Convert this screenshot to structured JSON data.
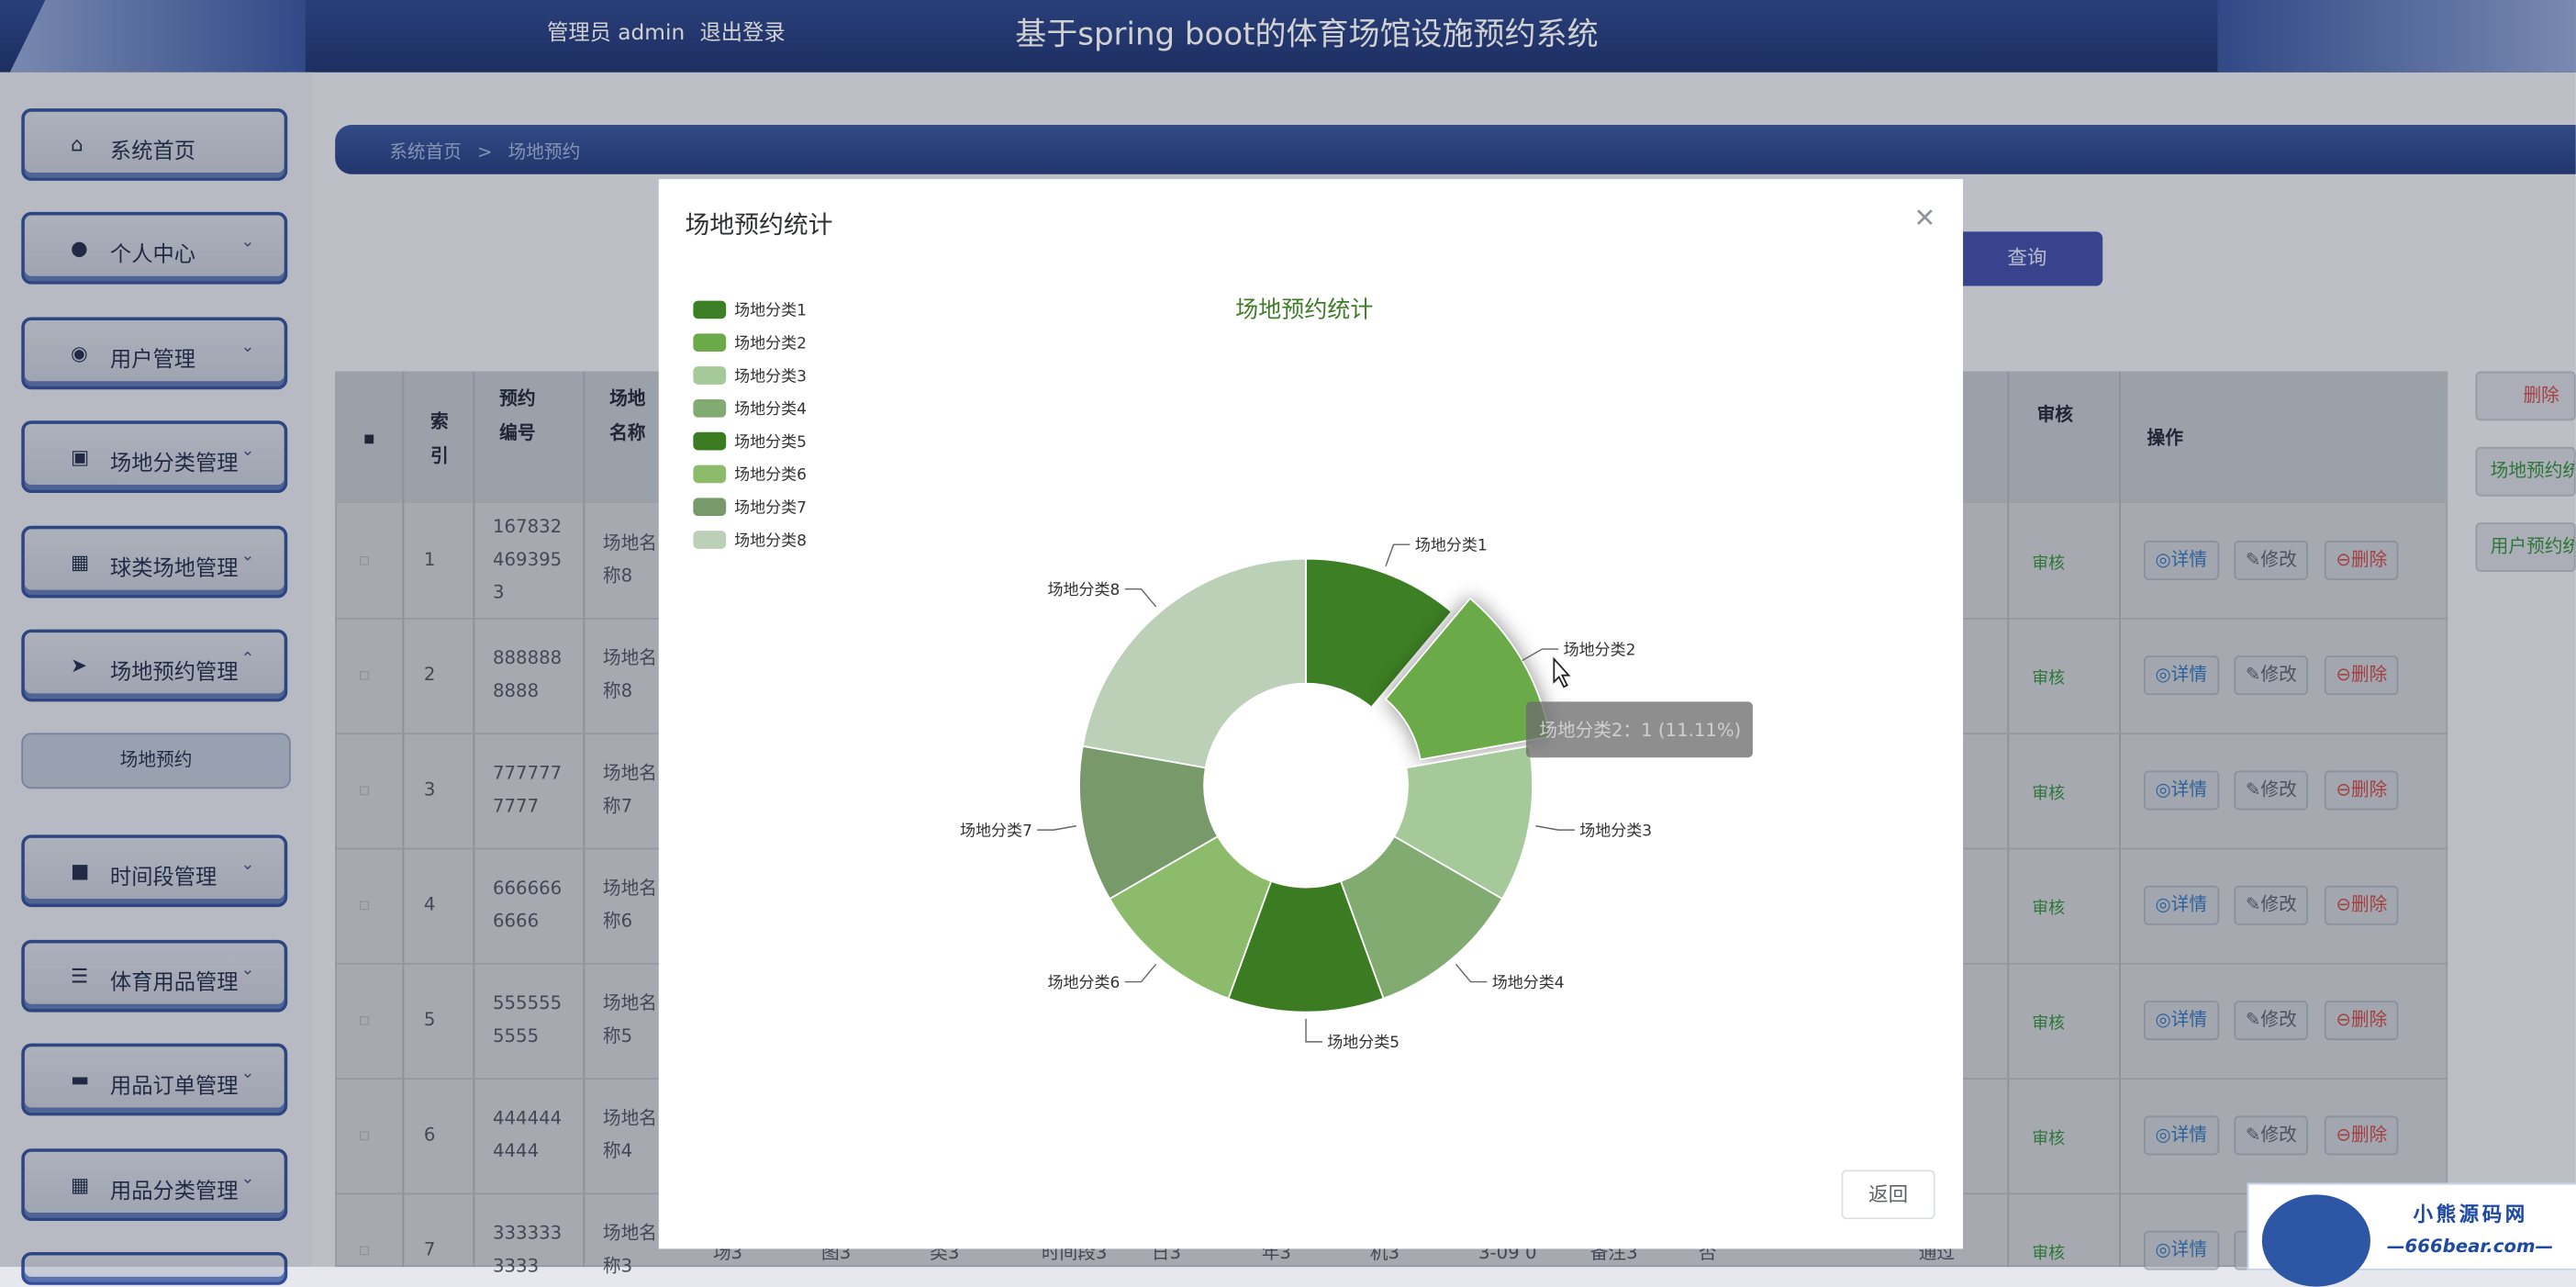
{
  "header": {
    "admin_label": "管理员 admin",
    "logout_label": "退出登录",
    "app_title": "基于spring boot的体育场馆设施预约系统"
  },
  "sidebar": {
    "items": [
      {
        "label": "系统首页",
        "icon": "home-icon"
      },
      {
        "label": "个人中心",
        "icon": "user-icon"
      },
      {
        "label": "用户管理",
        "icon": "users-icon"
      },
      {
        "label": "场地分类管理",
        "icon": "clipboard-icon"
      },
      {
        "label": "球类场地管理",
        "icon": "grid-icon"
      },
      {
        "label": "场地预约管理",
        "icon": "send-icon"
      },
      {
        "label": "时间段管理",
        "icon": "briefcase-icon"
      },
      {
        "label": "体育用品管理",
        "icon": "list-icon"
      },
      {
        "label": "用品订单管理",
        "icon": "monitor-icon"
      },
      {
        "label": "用品分类管理",
        "icon": "grid-icon"
      }
    ],
    "subitem": "场地预约"
  },
  "breadcrumb": {
    "home": "系统首页",
    "sep": ">",
    "current": "场地预约"
  },
  "toolbar": {
    "query_label": "查询"
  },
  "side_buttons": {
    "delete": "删除",
    "stats1": "场地预约统计",
    "stats2": "用户预约统计"
  },
  "table": {
    "headers": {
      "index": "索引",
      "booking_no": "预约编号",
      "venue_name": "场地名称",
      "audit": "审核",
      "ops": "操作"
    },
    "rows": [
      {
        "index": "1",
        "no": [
          "167832",
          "469395",
          "3"
        ],
        "name": [
          "场地名",
          "称8"
        ]
      },
      {
        "index": "2",
        "no": [
          "888888",
          "8888"
        ],
        "name": [
          "场地名",
          "称8"
        ]
      },
      {
        "index": "3",
        "no": [
          "777777",
          "7777"
        ],
        "name": [
          "场地名",
          "称7"
        ]
      },
      {
        "index": "4",
        "no": [
          "666666",
          "6666"
        ],
        "name": [
          "场地名",
          "称6"
        ]
      },
      {
        "index": "5",
        "no": [
          "555555",
          "5555"
        ],
        "name": [
          "场地名",
          "称5"
        ]
      },
      {
        "index": "6",
        "no": [
          "444444",
          "4444"
        ],
        "name": [
          "场地名",
          "称4"
        ]
      },
      {
        "index": "7",
        "no": [
          "333333",
          "3333"
        ],
        "name": [
          "场地名",
          "称3"
        ]
      }
    ],
    "row7_extra": [
      "场3",
      "图3",
      "类3",
      "时间段3",
      "日3",
      "年3",
      "机3",
      "3-09 0",
      "备注3",
      "否",
      "通过"
    ],
    "audit_label": "审核",
    "detail_label": "详情",
    "edit_label": "修改",
    "delete_label": "删除"
  },
  "modal": {
    "title": "场地预约统计",
    "close_icon": "close-icon",
    "return_label": "返回",
    "tooltip": "场地分类2：1 (11.11%)"
  },
  "chart_data": {
    "type": "pie",
    "title": "场地预约统计",
    "categories": [
      "场地分类1",
      "场地分类2",
      "场地分类3",
      "场地分类4",
      "场地分类5",
      "场地分类6",
      "场地分类7",
      "场地分类8"
    ],
    "values": [
      1,
      1,
      1,
      1,
      1,
      1,
      1,
      2
    ],
    "colors": [
      "#3d7f24",
      "#6aaa48",
      "#a6c99a",
      "#82ab72",
      "#3b7c22",
      "#8dbb6c",
      "#789a6a",
      "#bcd0b8"
    ],
    "donut": true,
    "highlighted": "场地分类2",
    "legend_position": "top-left"
  },
  "watermark": {
    "line1": "小熊源码网",
    "line2": "—666bear.com—"
  }
}
